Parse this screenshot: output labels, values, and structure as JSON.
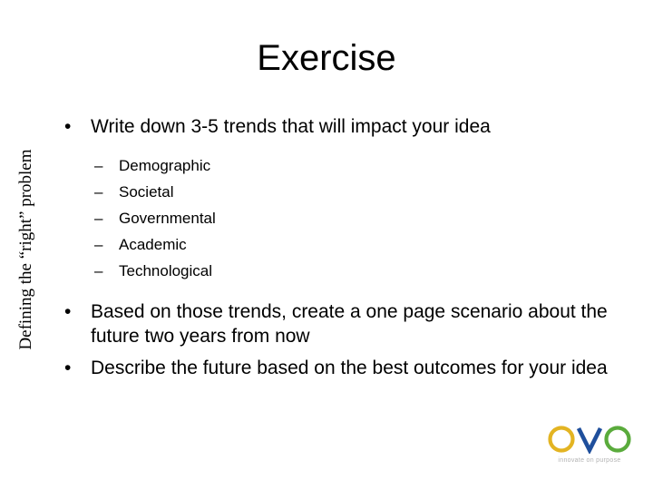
{
  "slide": {
    "title": "Exercise",
    "side_label": "Defining the “right” problem",
    "background_color": "#ffffff",
    "text_color": "#000000"
  },
  "bullets": {
    "level1_marker": "•",
    "level2_marker": "–",
    "items": [
      {
        "level": 1,
        "text": "Write down 3-5 trends that will impact your idea"
      },
      {
        "level": 2,
        "text": "Demographic"
      },
      {
        "level": 2,
        "text": "Societal"
      },
      {
        "level": 2,
        "text": "Governmental"
      },
      {
        "level": 2,
        "text": "Academic"
      },
      {
        "level": 2,
        "text": "Technological"
      },
      {
        "level": 1,
        "text": "Based on those trends, create a one page scenario about the future two years from now"
      },
      {
        "level": 1,
        "text": "Describe the future based on the best outcomes for your idea"
      }
    ]
  },
  "logo": {
    "name": "ovo-logo",
    "letters": {
      "first_o": "O",
      "v": "V",
      "second_o": "O"
    },
    "tagline": "innovate on purpose",
    "colors": {
      "gold": "#e3b422",
      "blue": "#1f4f9c",
      "green": "#5aab3c",
      "tagline": "#b3b3b3"
    }
  }
}
